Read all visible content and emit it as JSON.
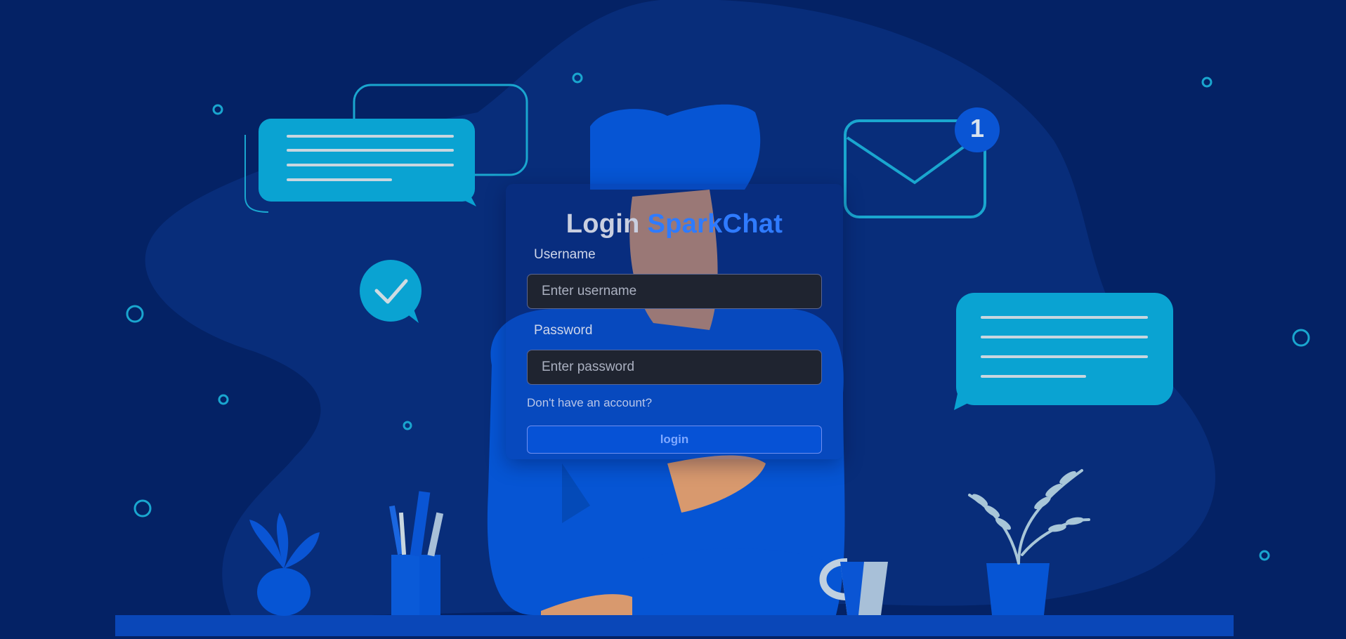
{
  "login": {
    "title_prefix": "Login",
    "title_brand": "SparkChat",
    "username_label": "Username",
    "username_placeholder": "Enter username",
    "username_value": "",
    "password_label": "Password",
    "password_placeholder": "Enter password",
    "password_value": "",
    "signup_link": "Don't have an account?",
    "submit_label": "login"
  },
  "illustration": {
    "mail_badge_count": "1",
    "icons": [
      "chat-bubble-icon",
      "check-bubble-icon",
      "mail-icon",
      "plant-icon",
      "mug-icon",
      "pencil-cup-icon"
    ]
  },
  "colors": {
    "background": "#042265",
    "blob": "#082d7a",
    "accent": "#0e9ccc",
    "brand": "#2f7bff",
    "figure": "#0655d4",
    "desk": "#0a47b8"
  }
}
